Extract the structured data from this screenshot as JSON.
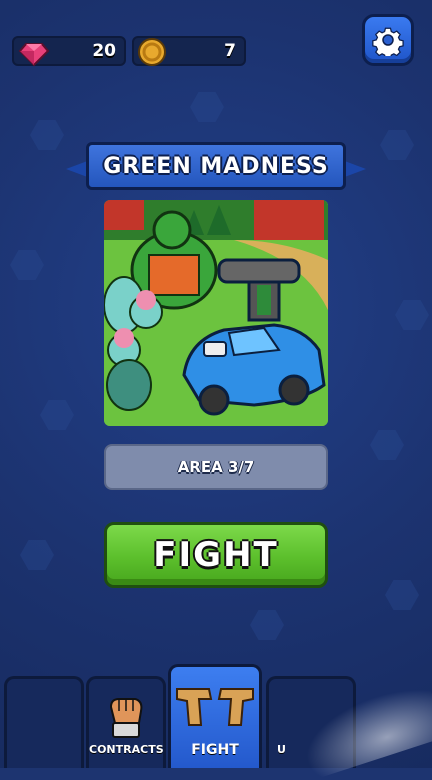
{
  "currencies": {
    "gems": "20",
    "coins": "7"
  },
  "level": {
    "title": "GREEN MADNESS",
    "area": "AREA 3/7"
  },
  "actions": {
    "fight": "FIGHT"
  },
  "nav": {
    "tabs": [
      {
        "label": "",
        "icon": "empty-slot"
      },
      {
        "label": "CONTRACTS",
        "icon": "fist-icon"
      },
      {
        "label": "FIGHT",
        "icon": "pistols-icon",
        "active": true
      },
      {
        "label": "U",
        "icon": "upgrade-icon"
      }
    ]
  },
  "colors": {
    "background": "#1d3470",
    "fight_button": "#5cbf2c",
    "active_tab": "#2f6be0",
    "banner": "#2f63cc"
  }
}
